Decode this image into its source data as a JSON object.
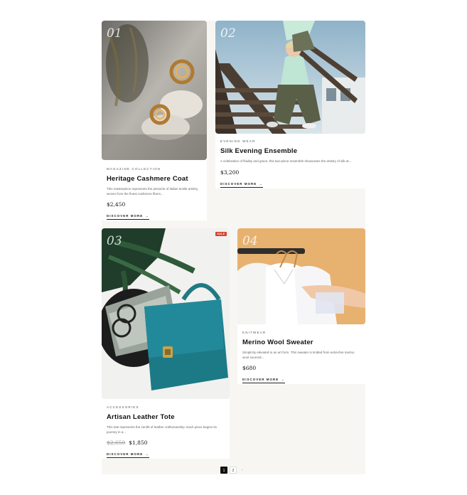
{
  "products": [
    {
      "number": "01",
      "category": "Magazine Collection",
      "title": "Heritage Cashmere Coat",
      "description": "This masterpiece represents the pinnacle of Italian textile artistry, woven from the finest cashmere fibers...",
      "price": "$2,450",
      "cta": "Discover More",
      "image": "gold-earrings-on-stone"
    },
    {
      "number": "02",
      "category": "Evening Wear",
      "title": "Silk Evening Ensemble",
      "description": "A celebration of fluidity and grace, this two-piece ensemble showcases the artistry of silk at...",
      "price": "$3,200",
      "cta": "Discover More",
      "image": "model-in-mint-hoodie-on-stairs"
    },
    {
      "number": "03",
      "category": "Accessories",
      "title": "Artisan Leather Tote",
      "description": "This tote represents the zenith of leather craftsmanship. Each piece begins its journey in a...",
      "price_old": "$2,650",
      "price": "$1,850",
      "badge": "SALE",
      "cta": "Discover More",
      "image": "teal-leather-handbag"
    },
    {
      "number": "04",
      "category": "Knitwear",
      "title": "Merino Wool Sweater",
      "description": "Simplicity elevated to an art form. This sweater is knitted from extra-fine merino wool sourced...",
      "price": "$680",
      "cta": "Discover More",
      "image": "white-shirts-on-hangers"
    }
  ],
  "pagination": {
    "pages": [
      "1",
      "2"
    ],
    "current": "1",
    "next_icon": "chevron-right-icon"
  },
  "colors": {
    "sale": "#d4452f",
    "active_page": "#111111",
    "canvas": "#f7f6f3"
  }
}
